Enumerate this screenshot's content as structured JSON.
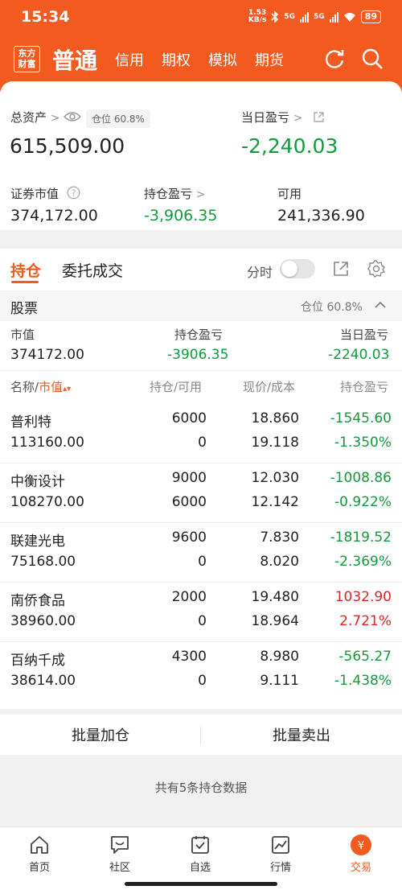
{
  "status": {
    "time": "15:34",
    "speed_top": "1.53",
    "speed_unit": "KB/s",
    "net1": "5G",
    "net2": "5G",
    "battery": "89"
  },
  "header": {
    "logo_line1": "东方",
    "logo_line2": "财富",
    "tabs": [
      {
        "label": "普通",
        "active": true
      },
      {
        "label": "信用"
      },
      {
        "label": "期权"
      },
      {
        "label": "模拟"
      },
      {
        "label": "期货"
      }
    ]
  },
  "summary": {
    "total_assets_label": "总资产",
    "position_tag": "仓位 60.8%",
    "total_assets": "615,509.00",
    "daily_pl_label": "当日盈亏",
    "daily_pl": "-2,240.03",
    "market_value_label": "证券市值",
    "market_value": "374,172.00",
    "holding_pl_label": "持仓盈亏",
    "holding_pl": "-3,906.35",
    "available_label": "可用",
    "available": "241,336.90",
    "gt": ">"
  },
  "holdings": {
    "tab_positions": "持仓",
    "tab_orders": "委托成交",
    "time_label": "分时",
    "section_title": "股票",
    "section_position": "仓位 60.8%",
    "summary_headers": {
      "mv": "市值",
      "hpl": "持仓盈亏",
      "dpl": "当日盈亏"
    },
    "summary_values": {
      "mv": "374172.00",
      "hpl": "-3906.35",
      "dpl": "-2240.03"
    },
    "columns": {
      "name": "名称/",
      "mv": "市值",
      "qty": "持仓/可用",
      "price": "现价/成本",
      "pl": "持仓盈亏"
    },
    "rows": [
      {
        "name": "普利特",
        "mv": "113160.00",
        "qty": "6000",
        "avail": "0",
        "price": "18.860",
        "cost": "19.118",
        "pl": "-1545.60",
        "pct": "-1.350%"
      },
      {
        "name": "中衡设计",
        "mv": "108270.00",
        "qty": "9000",
        "avail": "6000",
        "price": "12.030",
        "cost": "12.142",
        "pl": "-1008.86",
        "pct": "-0.922%"
      },
      {
        "name": "联建光电",
        "mv": "75168.00",
        "qty": "9600",
        "avail": "0",
        "price": "7.830",
        "cost": "8.020",
        "pl": "-1819.52",
        "pct": "-2.369%"
      },
      {
        "name": "南侨食品",
        "mv": "38960.00",
        "qty": "2000",
        "avail": "0",
        "price": "19.480",
        "cost": "18.964",
        "pl": "1032.90",
        "pct": "2.721%"
      },
      {
        "name": "百纳千成",
        "mv": "38614.00",
        "qty": "4300",
        "avail": "0",
        "price": "8.980",
        "cost": "9.111",
        "pl": "-565.27",
        "pct": "-1.438%"
      }
    ]
  },
  "actions": {
    "add": "批量加仓",
    "sell": "批量卖出"
  },
  "footer_note": "共有5条持仓数据",
  "tabbar": [
    {
      "label": "首页",
      "icon": "home-icon"
    },
    {
      "label": "社区",
      "icon": "community-icon"
    },
    {
      "label": "自选",
      "icon": "watchlist-icon"
    },
    {
      "label": "行情",
      "icon": "market-icon"
    },
    {
      "label": "交易",
      "icon": "trade-icon",
      "active": true
    }
  ],
  "colors": {
    "brand": "#f35a1f",
    "down": "#149a3c",
    "up": "#e02424"
  }
}
